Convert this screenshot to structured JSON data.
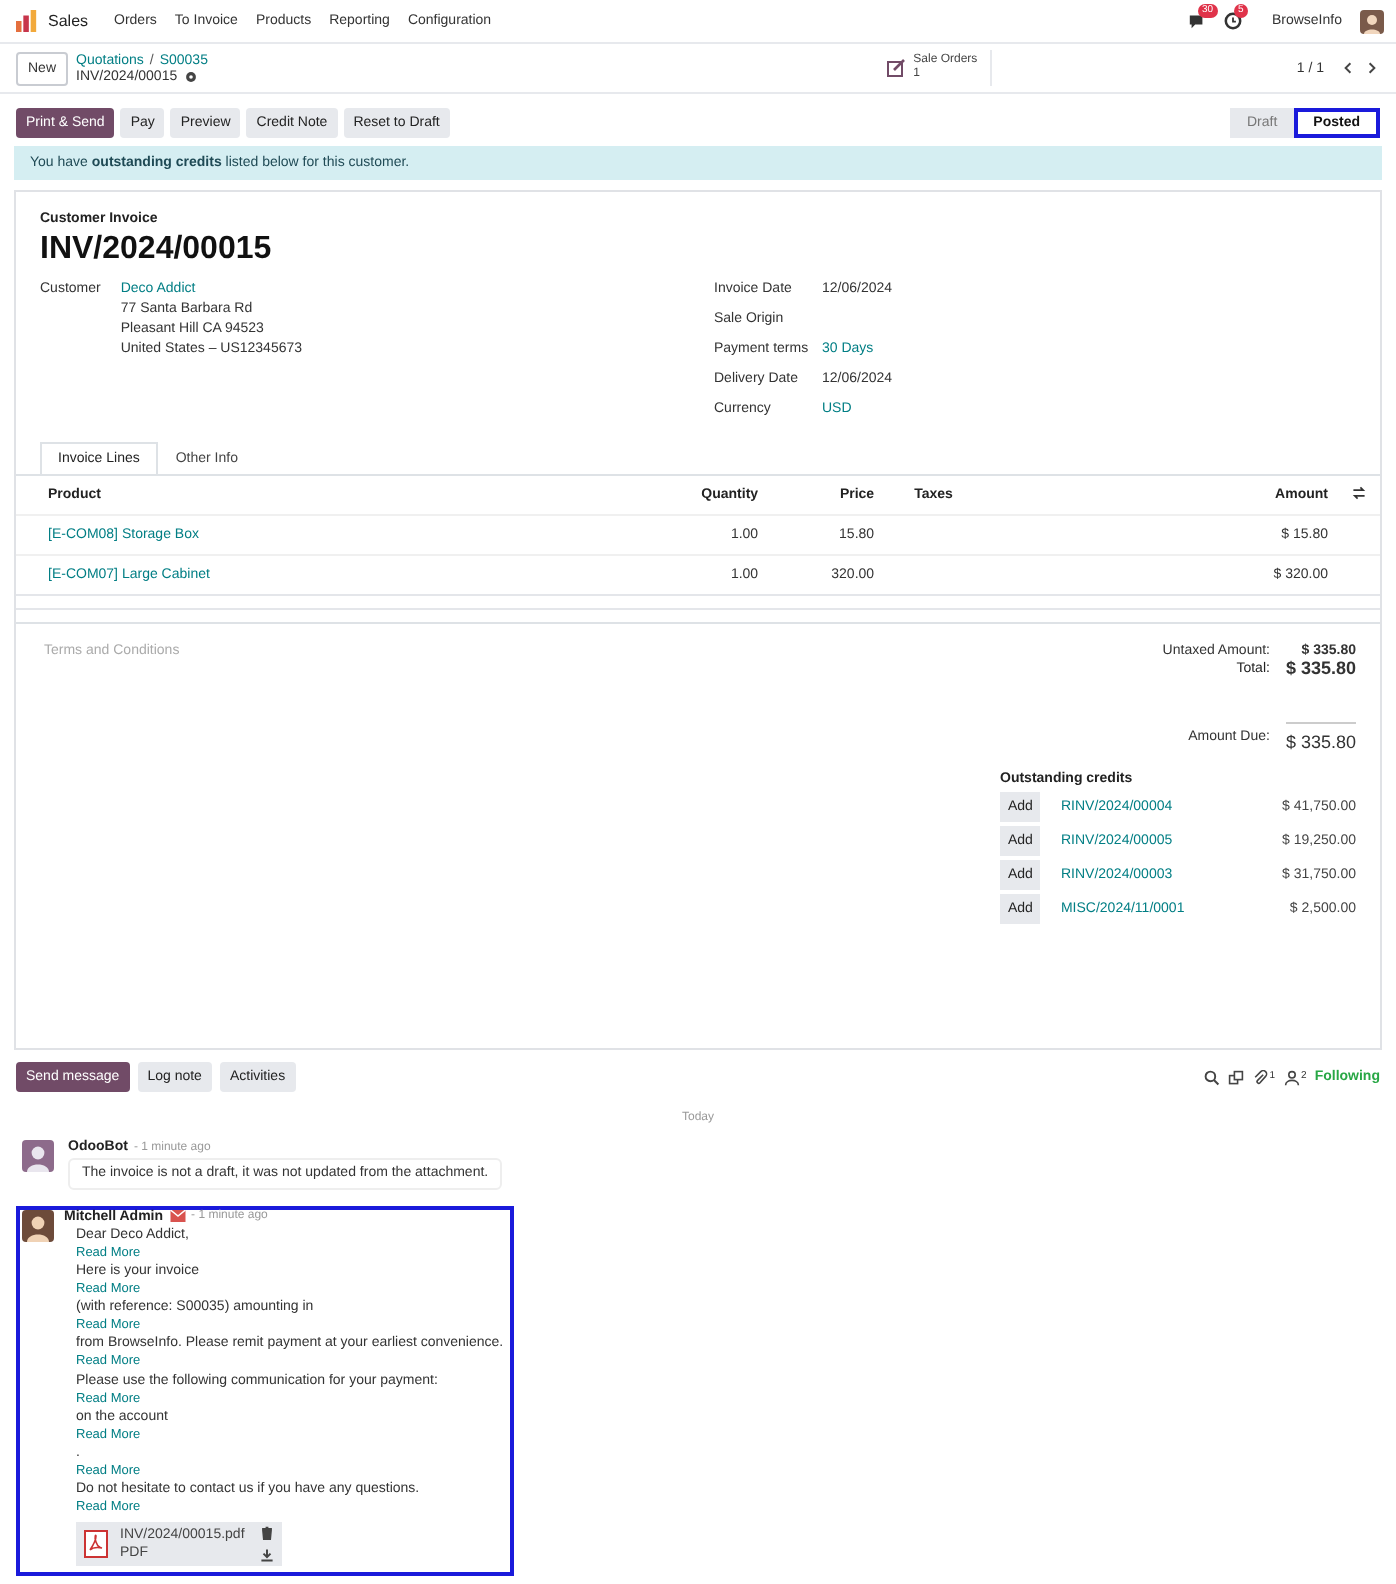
{
  "navbar": {
    "app": "Sales",
    "menu": [
      "Orders",
      "To Invoice",
      "Products",
      "Reporting",
      "Configuration"
    ],
    "messages_badge": "30",
    "activities_badge": "5",
    "company": "BrowseInfo"
  },
  "control_panel": {
    "new_button": "New",
    "breadcrumb": [
      "Quotations",
      "S00035"
    ],
    "breadcrumb_separator": "/",
    "record": "INV/2024/00015",
    "smart_button": {
      "label": "Sale Orders",
      "count": "1"
    },
    "pager": "1 / 1"
  },
  "actions": [
    {
      "label": "Print & Send",
      "primary": true
    },
    {
      "label": "Pay",
      "primary": false
    },
    {
      "label": "Preview",
      "primary": false
    },
    {
      "label": "Credit Note",
      "primary": false
    },
    {
      "label": "Reset to Draft",
      "primary": false
    }
  ],
  "statusbar": [
    {
      "label": "Draft",
      "selected": false
    },
    {
      "label": "Posted",
      "selected": true
    }
  ],
  "alert": "You have **outstanding credits** listed below for this customer.",
  "sheet": {
    "type_label": "Customer Invoice",
    "number": "INV/2024/00015",
    "customer": {
      "label": "Customer",
      "name": "Deco Addict",
      "address": [
        "77 Santa Barbara Rd",
        "Pleasant Hill CA 94523",
        "United States – US12345673"
      ]
    },
    "fields": [
      {
        "label": "Invoice Date",
        "value": "12/06/2024",
        "link": false
      },
      {
        "label": "Sale Origin"
      },
      {
        "label": "Payment terms",
        "value": "30 Days",
        "link": true
      },
      {
        "label": "Delivery Date",
        "value": "12/06/2024",
        "link": false
      },
      {
        "label": "Currency",
        "value": "USD",
        "link": true
      }
    ],
    "tabs": [
      {
        "label": "Invoice Lines",
        "selected": true
      },
      {
        "label": "Other Info",
        "selected": false
      }
    ],
    "table": {
      "columns": [
        "Product",
        "Quantity",
        "Price",
        "Taxes",
        "Amount"
      ],
      "rows": [
        {
          "product": "[E-COM08] Storage Box",
          "quantity": "1.00",
          "price": "15.80",
          "amount": "$ 15.80"
        },
        {
          "product": "[E-COM07] Large Cabinet",
          "quantity": "1.00",
          "price": "320.00",
          "amount": "$ 320.00"
        }
      ]
    },
    "terms_placeholder": "Terms and Conditions",
    "totals": [
      {
        "label": "Untaxed Amount:",
        "value": "$ 335.80",
        "kind": "sub"
      },
      {
        "label": "Total:",
        "value": "$ 335.80",
        "kind": "total"
      },
      {
        "label": "Amount Due:",
        "value": "$ 335.80",
        "kind": "due"
      }
    ],
    "outstanding": {
      "title": "Outstanding credits",
      "items": [
        {
          "button": "Add",
          "ref": "RINV/2024/00004",
          "amount": "$ 41,750.00"
        },
        {
          "button": "Add",
          "ref": "RINV/2024/00005",
          "amount": "$ 19,250.00"
        },
        {
          "button": "Add",
          "ref": "RINV/2024/00003",
          "amount": "$ 31,750.00"
        },
        {
          "button": "Add",
          "ref": "MISC/2024/11/0001",
          "amount": "$ 2,500.00"
        }
      ]
    }
  },
  "chatter": {
    "buttons": [
      {
        "label": "Send message",
        "primary": true
      },
      {
        "label": "Log note",
        "primary": false
      },
      {
        "label": "Activities",
        "primary": false
      }
    ],
    "attachments_count": "1",
    "followers_count": "2",
    "follow": "Following",
    "separator": "Today",
    "messages": [
      {
        "author": "OdooBot",
        "time": "- 1 minute ago",
        "selected": false,
        "email": false,
        "bubble": true,
        "lines": [
          {
            "text": "The invoice is not a draft, it was not updated from the attachment."
          }
        ]
      },
      {
        "author": "Mitchell Admin",
        "time": "- 1 minute ago",
        "selected": true,
        "email": true,
        "bubble": false,
        "lines": [
          {
            "text": "Dear Deco Addict,",
            "link": "Read More"
          },
          {
            "text": "Here is your invoice",
            "link": "Read More"
          },
          {
            "text": "(with reference: S00035) amounting in",
            "link": "Read More"
          },
          {
            "text": "from BrowseInfo. Please remit payment at your earliest convenience.",
            "link": "Read More"
          },
          {
            "text": "Please use the following communication for your payment:",
            "link": "Read More"
          },
          {
            "text": "on the account",
            "link": "Read More"
          },
          {
            "text": ".",
            "link": "Read More"
          },
          {
            "text": "Do not hesitate to contact us if you have any questions.",
            "link": "Read More"
          }
        ],
        "attachment": {
          "name": "INV/2024/00015.pdf",
          "type": "PDF"
        }
      }
    ]
  }
}
